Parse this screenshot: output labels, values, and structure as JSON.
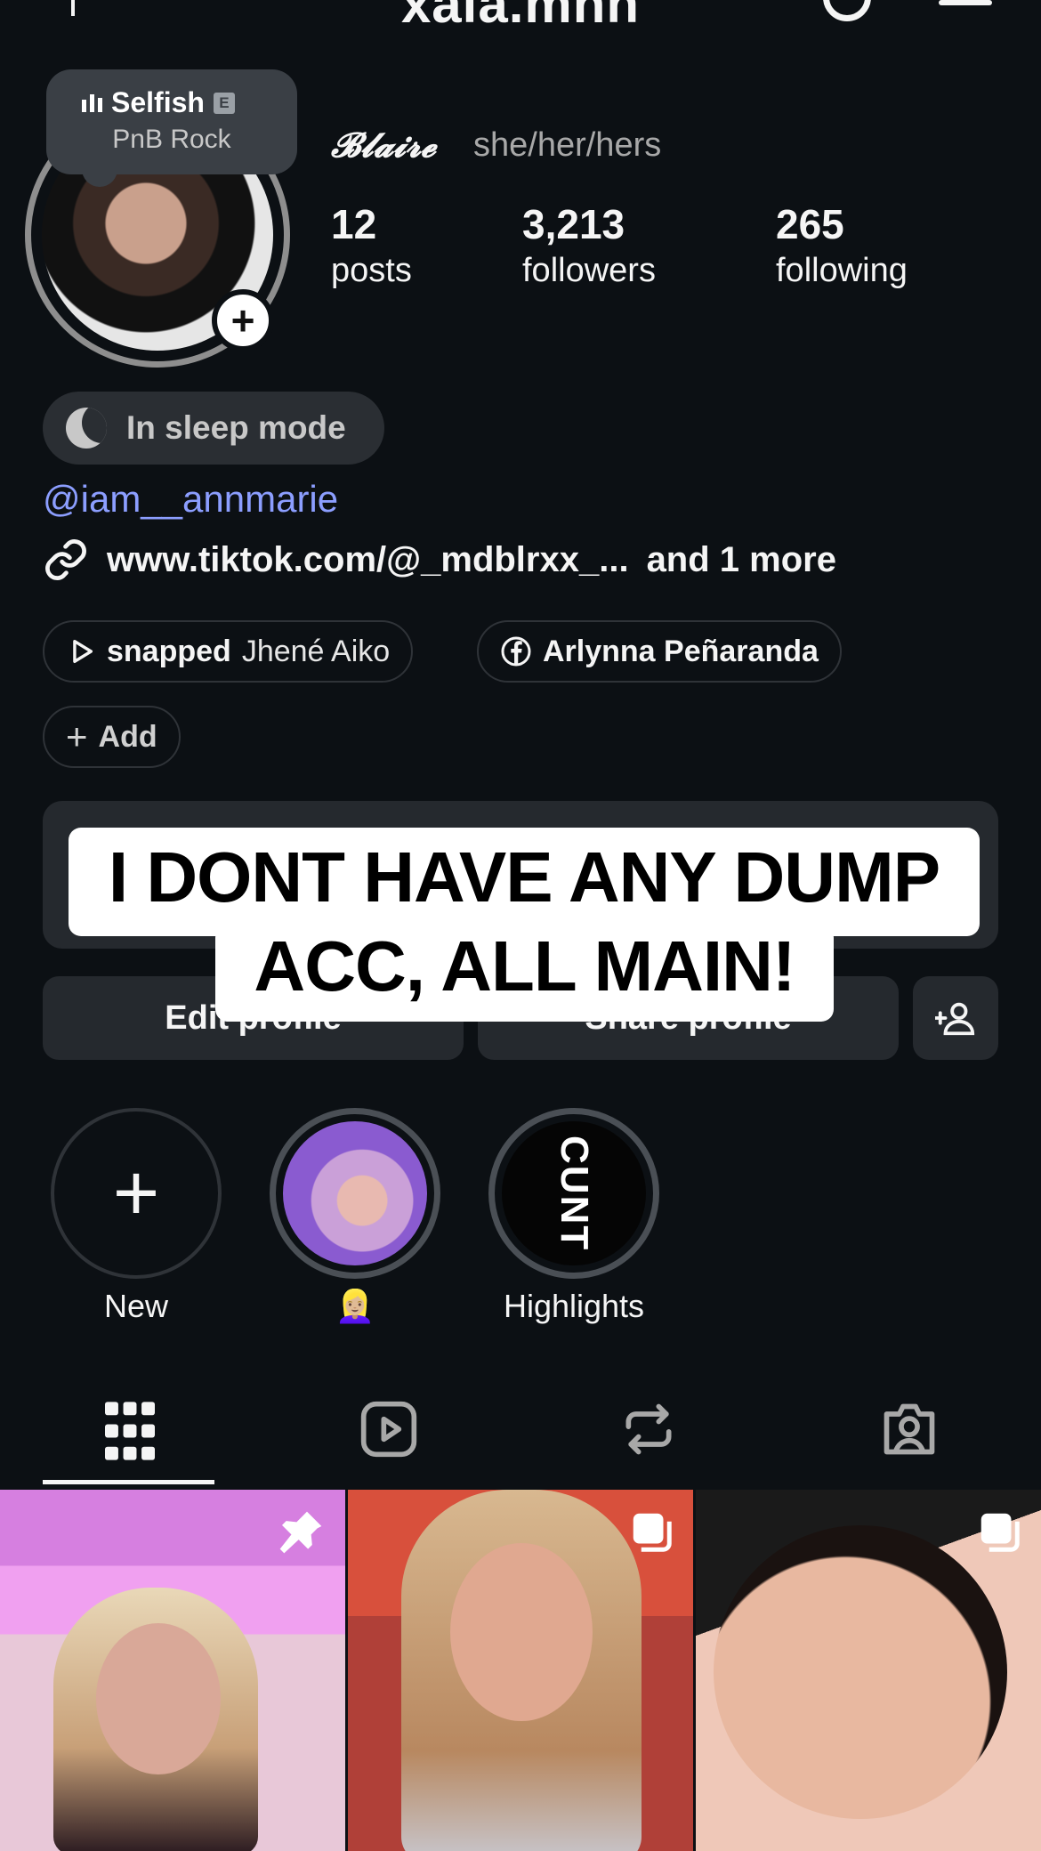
{
  "header": {
    "username": "xala.mnh"
  },
  "now_playing": {
    "title": "Selfish",
    "explicit": "E",
    "artist": "PnB Rock"
  },
  "profile": {
    "display_name": "𝓑𝓵𝓪𝓲𝓻𝓮",
    "pronouns": "she/her/hers",
    "stats": [
      {
        "value": "12",
        "label": "posts"
      },
      {
        "value": "3,213",
        "label": "followers"
      },
      {
        "value": "265",
        "label": "following"
      }
    ],
    "status": "In sleep mode",
    "mention": "@iam__annmarie",
    "link": "www.tiktok.com/@_mdblrxx_...",
    "link_more": "and 1 more",
    "chips": [
      {
        "bold": "snapped",
        "light": "Jhené Aiko",
        "icon": "play-icon"
      },
      {
        "bold": "Arlynna Peñaranda",
        "icon": "facebook-icon"
      }
    ],
    "add_label": "Add"
  },
  "caption": {
    "line1": "I DONT HAVE ANY DUMP",
    "line2": "ACC, ALL MAIN!"
  },
  "buttons": {
    "edit": "Edit profile",
    "share": "Share profile"
  },
  "highlights": [
    {
      "label": "New"
    },
    {
      "label": "👱🏼‍♀️"
    },
    {
      "label": "Highlights",
      "cover_text": "CUNT"
    }
  ],
  "tabs": [
    "grid-icon",
    "reels-icon",
    "reposts-icon",
    "tagged-icon"
  ]
}
